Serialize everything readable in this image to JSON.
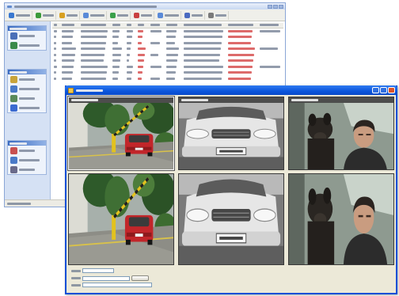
{
  "background_window": {
    "title": "",
    "toolbar_buttons": [
      {
        "label": "",
        "icon": "toolbar-icon",
        "color": "#3a78d0"
      },
      {
        "label": "",
        "icon": "toolbar-icon",
        "color": "#3a9a3a"
      },
      {
        "label": "",
        "icon": "toolbar-icon",
        "color": "#d8a020"
      },
      {
        "label": "",
        "icon": "toolbar-icon",
        "color": "#5a8ad8"
      },
      {
        "label": "",
        "icon": "toolbar-icon",
        "color": "#3aa04a"
      },
      {
        "label": "",
        "icon": "toolbar-icon",
        "color": "#c84040"
      },
      {
        "label": "",
        "icon": "toolbar-icon",
        "color": "#5a8ad8"
      },
      {
        "label": "",
        "icon": "toolbar-icon",
        "color": "#4a6ac0"
      },
      {
        "label": "",
        "icon": "toolbar-icon",
        "color": "#7a7a7a"
      }
    ],
    "side_panels": [
      {
        "title": "",
        "items": [
          {
            "label": "",
            "icon": "camera-icon",
            "color": "#4a6fb8"
          },
          {
            "label": "",
            "icon": "person-icon",
            "color": "#3a8a4a"
          }
        ]
      },
      {
        "title": "",
        "items": [
          {
            "label": "",
            "icon": "document-icon",
            "color": "#c9a43a"
          },
          {
            "label": "",
            "icon": "person-icon",
            "color": "#4a7ac8"
          },
          {
            "label": "",
            "icon": "database-icon",
            "color": "#5a8a5a"
          },
          {
            "label": "",
            "icon": "globe-icon",
            "color": "#3a6ad0"
          }
        ]
      },
      {
        "title": "",
        "items": [
          {
            "label": "",
            "icon": "document-icon",
            "color": "#c85050"
          },
          {
            "label": "",
            "icon": "person-icon",
            "color": "#4a7ac8"
          },
          {
            "label": "",
            "icon": "printer-icon",
            "color": "#6a6a8a"
          }
        ]
      }
    ],
    "status": ""
  },
  "viewer_window": {
    "title": "",
    "tiles": [
      {
        "label": ""
      },
      {
        "label": ""
      },
      {
        "label": ""
      },
      {
        "label": ""
      },
      {
        "label": ""
      },
      {
        "label": ""
      }
    ],
    "form": {
      "label": "",
      "button": ""
    }
  },
  "colors": {
    "xp_title_blue": "#0a55dc",
    "panel_blue": "#3b6cc2",
    "alert_red": "#d23a3a"
  }
}
